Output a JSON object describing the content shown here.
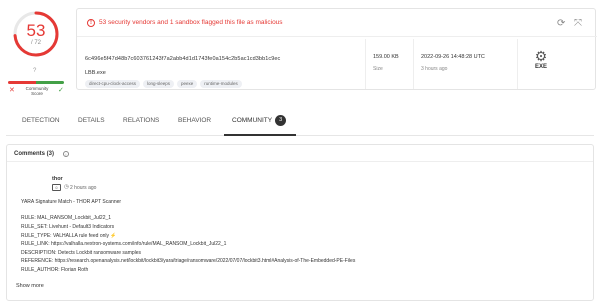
{
  "score": {
    "detected": "53",
    "total": "/ 72",
    "question": "?",
    "community_label": "Community Score",
    "ring_fraction": 0.736,
    "accent": "#e53935",
    "good": "#43a047"
  },
  "banner": {
    "alert_icon": "alert-circle-icon",
    "text": "53 security vendors and 1 sandbox flagged this file as malicious"
  },
  "file": {
    "hash": "6c496e5f47d48b7c603761243f7a2abb4d1d1743fe0a154c2b5ac1cd3bb1c9ec",
    "name": "LBB.exe",
    "tags": [
      "direct-cpu-clock-access",
      "long-sleeps",
      "peexe",
      "runtime-modules"
    ],
    "size_value": "159.00 KB",
    "size_label": "Size",
    "date_value": "2022-09-26 14:48:28 UTC",
    "date_label": "3 hours ago",
    "type_label": "EXE"
  },
  "tabs": [
    {
      "label": "DETECTION"
    },
    {
      "label": "DETAILS"
    },
    {
      "label": "RELATIONS"
    },
    {
      "label": "BEHAVIOR"
    },
    {
      "label": "COMMUNITY",
      "badge": "3"
    }
  ],
  "comments": {
    "title": "Comments (3)",
    "author": "thor",
    "time": "2 hours ago",
    "lines": [
      "YARA Signature Match - THOR APT Scanner",
      "RULE: MAL_RANSOM_Lockbit_Jul22_1",
      "RULE_SET: Livehunt - Default3 Indicators",
      "RULE_TYPE: VALHALLA rule feed only ⚡",
      "RULE_LINK: https://valhalla.nextron-systems.com/info/rule/MAL_RANSOM_Lockbit_Jul22_1",
      "DESCRIPTION: Detects Lockbit ransomware samples",
      "REFERENCE: https://research.openanalysis.net/lockbit/lockbit3/yara/triage/ransomware/2022/07/07/lockbit3.html#Analysis-of-The-Embedded-PE-Files",
      "RULE_AUTHOR: Florian Roth"
    ],
    "show_more": "Show more"
  }
}
